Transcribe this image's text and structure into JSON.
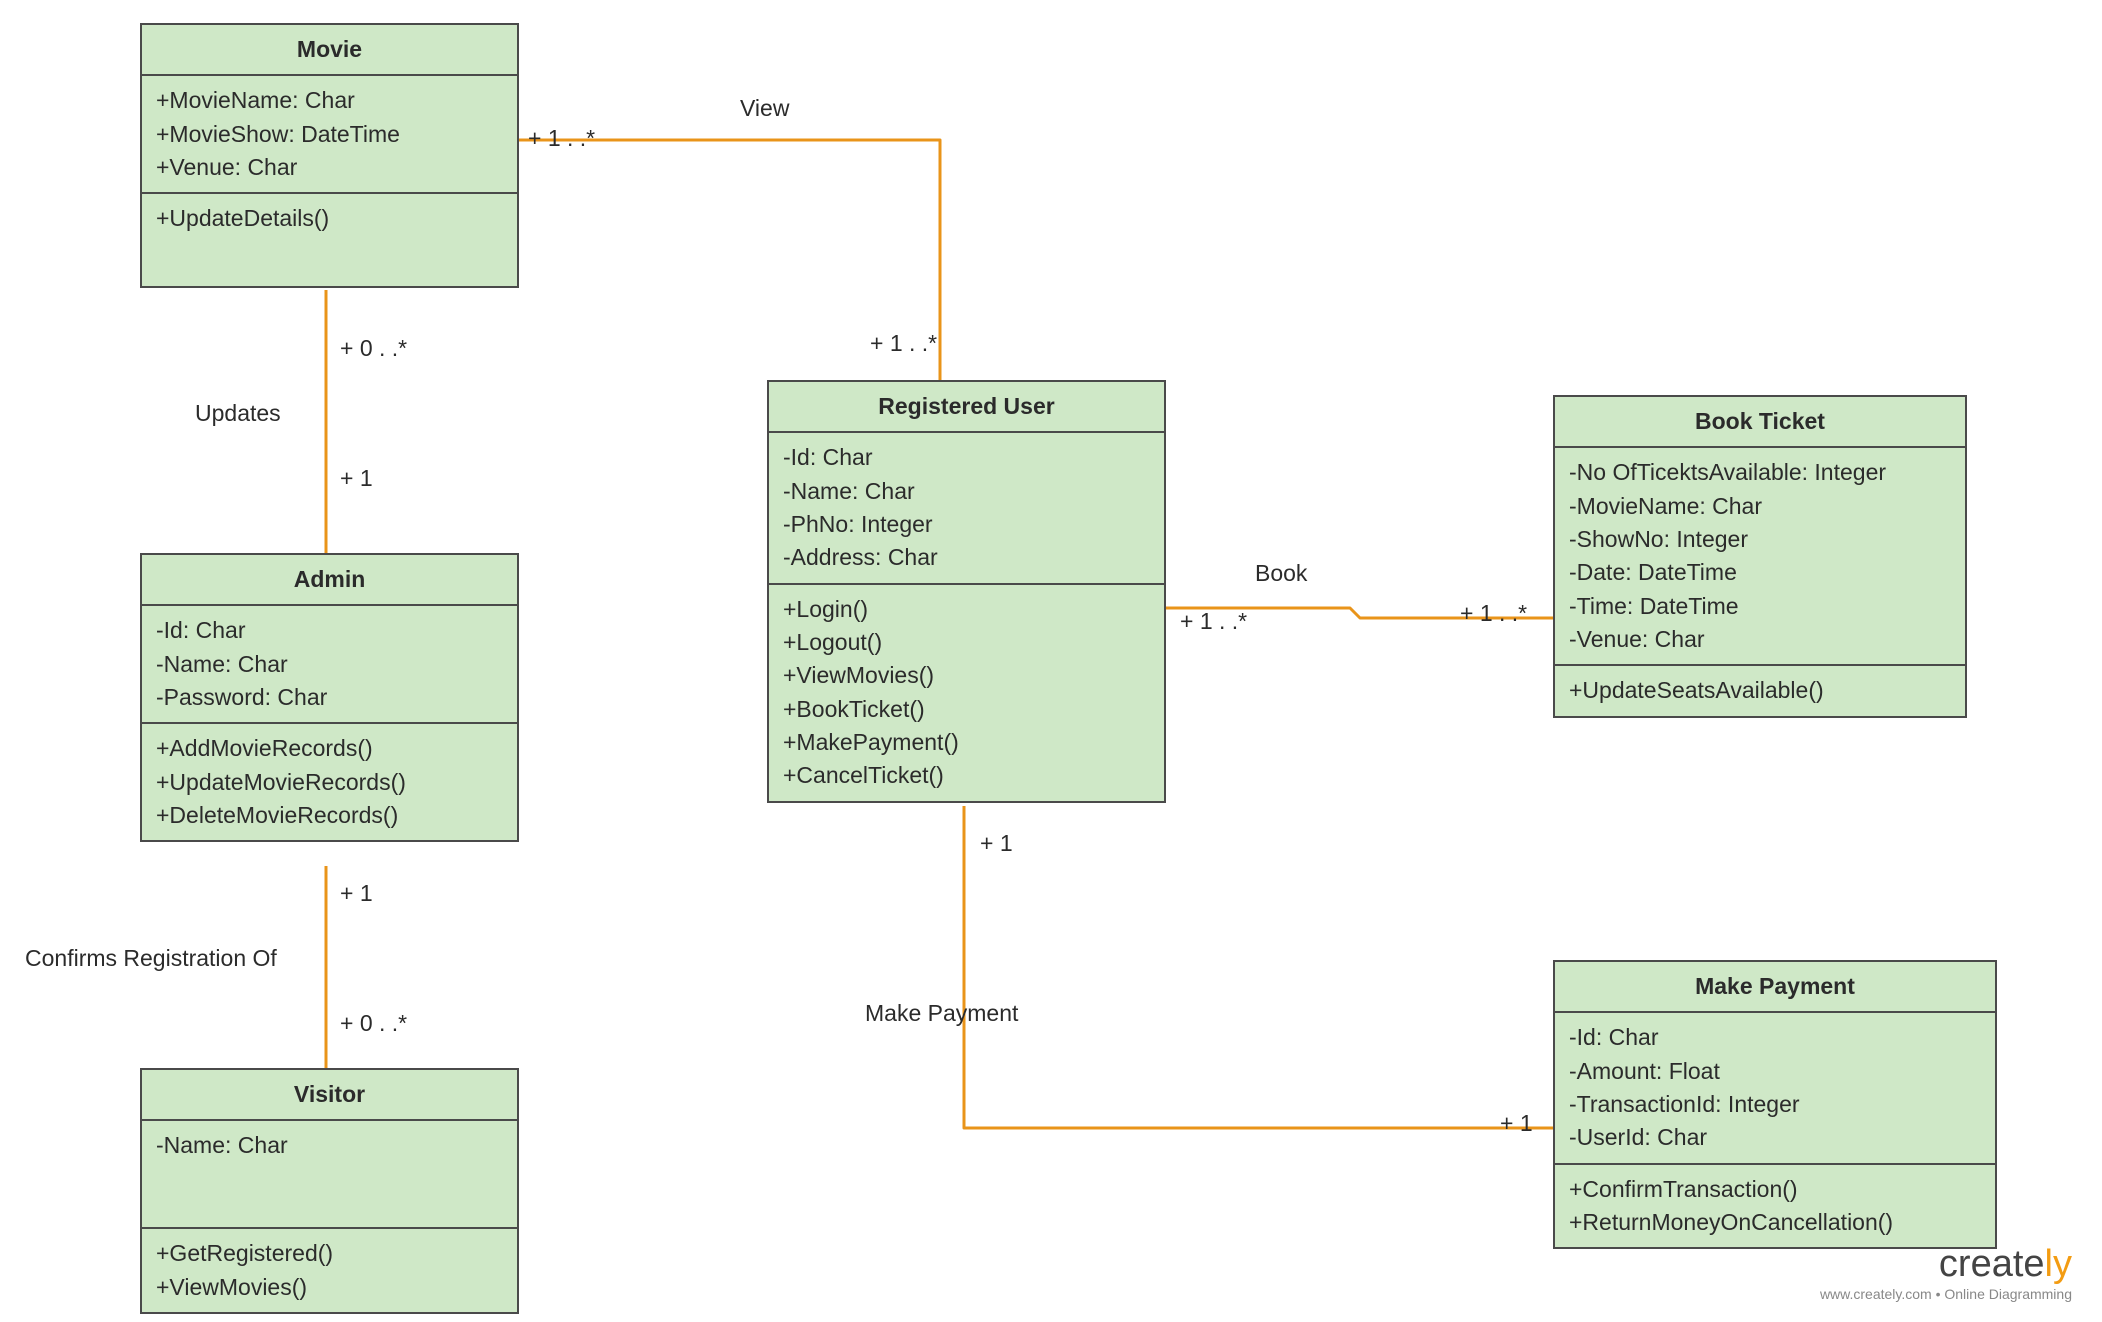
{
  "classes": {
    "movie": {
      "title": "Movie",
      "attrs": [
        "+MovieName: Char",
        "+MovieShow: DateTime",
        "+Venue: Char"
      ],
      "ops": [
        "+UpdateDetails()"
      ]
    },
    "admin": {
      "title": "Admin",
      "attrs": [
        "-Id: Char",
        "-Name: Char",
        "-Password: Char"
      ],
      "ops": [
        "+AddMovieRecords()",
        "+UpdateMovieRecords()",
        "+DeleteMovieRecords()"
      ]
    },
    "visitor": {
      "title": "Visitor",
      "attrs": [
        "-Name: Char"
      ],
      "ops": [
        "+GetRegistered()",
        "+ViewMovies()"
      ]
    },
    "registered_user": {
      "title": "Registered User",
      "attrs": [
        "-Id: Char",
        "-Name: Char",
        "-PhNo: Integer",
        "-Address: Char"
      ],
      "ops": [
        "+Login()",
        "+Logout()",
        "+ViewMovies()",
        "+BookTicket()",
        "+MakePayment()",
        "+CancelTicket()"
      ]
    },
    "book_ticket": {
      "title": "Book Ticket",
      "attrs": [
        "-No OfTicektsAvailable: Integer",
        "-MovieName: Char",
        "-ShowNo: Integer",
        "-Date: DateTime",
        "-Time: DateTime",
        "-Venue: Char"
      ],
      "ops": [
        "+UpdateSeatsAvailable()"
      ]
    },
    "make_payment": {
      "title": "Make Payment",
      "attrs": [
        "-Id: Char",
        "-Amount: Float",
        "-TransactionId: Integer",
        "-UserId: Char"
      ],
      "ops": [
        "+ConfirmTransaction()",
        "+ReturnMoneyOnCancellation()"
      ]
    }
  },
  "assoc": {
    "movie_admin": {
      "label": "Updates",
      "m1": "+ 0 . .*",
      "m2": "+ 1"
    },
    "admin_visitor": {
      "label": "Confirms Registration Of",
      "m1": "+ 1",
      "m2": "+ 0 . .*"
    },
    "movie_user": {
      "label": "View",
      "m1": "+ 1 . .*",
      "m2": "+ 1 . .*"
    },
    "user_book": {
      "label": "Book",
      "m1": "+ 1 . .*",
      "m2": "+ 1 . .*"
    },
    "user_pay": {
      "label": "Make Payment",
      "m1": "+ 1",
      "m2": "+ 1"
    }
  },
  "footer": {
    "brand_a": "create",
    "brand_b": "ly",
    "tagline": "www.creately.com • Online Diagramming"
  }
}
